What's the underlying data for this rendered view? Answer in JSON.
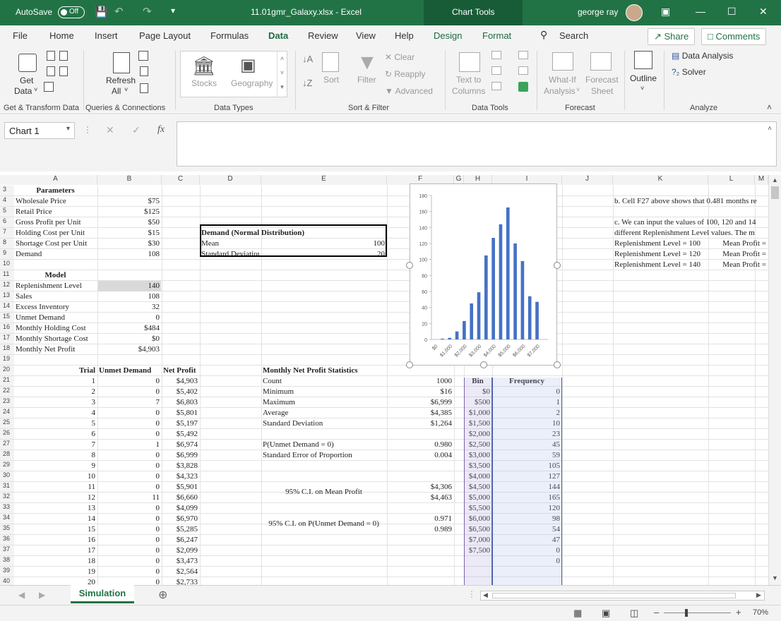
{
  "title_bar": {
    "autosave": "AutoSave",
    "autosave_state": "Off",
    "filename": "11.01gmr_Galaxy.xlsx  -  Excel",
    "context": "Chart Tools",
    "user": "george ray"
  },
  "tabs": [
    "File",
    "Home",
    "Insert",
    "Page Layout",
    "Formulas",
    "Data",
    "Review",
    "View",
    "Help",
    "Design",
    "Format"
  ],
  "search": "Search",
  "share": "Share",
  "comments": "Comments",
  "ribbon": {
    "get_data": "Get",
    "get_data2": "Data",
    "refresh": "Refresh",
    "refresh2": "All",
    "stocks": "Stocks",
    "geography": "Geography",
    "sort": "Sort",
    "filter": "Filter",
    "clear": "Clear",
    "reapply": "Reapply",
    "advanced": "Advanced",
    "text_to": "Text to",
    "columns": "Columns",
    "whatif": "What-If",
    "analysis": "Analysis",
    "forecast": "Forecast",
    "sheet": "Sheet",
    "outline": "Outline",
    "data_analysis": "Data Analysis",
    "solver": "Solver",
    "groups": [
      "Get & Transform Data",
      "Queries & Connections",
      "Data Types",
      "Sort & Filter",
      "Data Tools",
      "Forecast",
      "Analyze"
    ]
  },
  "name_box": "Chart 1",
  "columns": [
    "A",
    "B",
    "C",
    "D",
    "E",
    "F",
    "G",
    "H",
    "I",
    "J",
    "K",
    "L",
    "M"
  ],
  "params": {
    "title": "Parameters",
    "rows": [
      [
        "Wholesale Price",
        "$75"
      ],
      [
        "Retail Price",
        "$125"
      ],
      [
        "Gross Profit per Unit",
        "$50"
      ],
      [
        "Holding Cost per Unit",
        "$15"
      ],
      [
        "Shortage Cost per Unit",
        "$30"
      ],
      [
        "Demand",
        "108"
      ]
    ]
  },
  "demand_box": {
    "title": "Demand (Normal Distribution)",
    "mean_label": "Mean",
    "mean": "100",
    "sd_label": "Standard Deviation",
    "sd": "20"
  },
  "model": {
    "title": "Model",
    "rows": [
      [
        "Replenishment Level",
        "140"
      ],
      [
        "Sales",
        "108"
      ],
      [
        "Excess Inventory",
        "32"
      ],
      [
        "Unmet Demand",
        "0"
      ],
      [
        "Monthly Holding Cost",
        "$484"
      ],
      [
        "Monthly Shortage Cost",
        "$0"
      ],
      [
        "Monthly Net Profit",
        "$4,903"
      ]
    ]
  },
  "notes": {
    "k4": "b. Cell F27 above shows that 0.481 months re",
    "k6": "c. We can input the values of 100, 120 and 14",
    "k7": "different Replenishment Level values. The m",
    "rl": [
      [
        "Replenishment Level = 100",
        "Mean Profit ="
      ],
      [
        "Replenishment Level = 120",
        "Mean Profit ="
      ],
      [
        "Replenishment Level = 140",
        "Mean Profit ="
      ]
    ]
  },
  "trial_headers": [
    "Trial",
    "Unmet Demand",
    "Net Profit"
  ],
  "trials": [
    [
      "1",
      "0",
      "$4,903"
    ],
    [
      "2",
      "0",
      "$5,402"
    ],
    [
      "3",
      "7",
      "$6,803"
    ],
    [
      "4",
      "0",
      "$5,801"
    ],
    [
      "5",
      "0",
      "$5,197"
    ],
    [
      "6",
      "0",
      "$5,492"
    ],
    [
      "7",
      "1",
      "$6,974"
    ],
    [
      "8",
      "0",
      "$6,999"
    ],
    [
      "9",
      "0",
      "$3,828"
    ],
    [
      "10",
      "0",
      "$4,323"
    ],
    [
      "11",
      "0",
      "$5,901"
    ],
    [
      "12",
      "11",
      "$6,660"
    ],
    [
      "13",
      "0",
      "$4,099"
    ],
    [
      "14",
      "0",
      "$6,970"
    ],
    [
      "15",
      "0",
      "$5,285"
    ],
    [
      "16",
      "0",
      "$6,247"
    ],
    [
      "17",
      "0",
      "$2,099"
    ],
    [
      "18",
      "0",
      "$3,473"
    ],
    [
      "19",
      "0",
      "$2,564"
    ],
    [
      "20",
      "0",
      "$2,733"
    ]
  ],
  "stats": {
    "title": "Monthly Net Profit Statistics",
    "rows": [
      [
        "Count",
        "1000"
      ],
      [
        "Minimum",
        "$16"
      ],
      [
        "Maximum",
        "$6,999"
      ],
      [
        "Average",
        "$4,385"
      ],
      [
        "Standard Deviation",
        "$1,264"
      ]
    ],
    "p_unmet": "P(Unmet Demand = 0)",
    "p_unmet_val": "0.980",
    "se": "Standard Error of Proportion",
    "se_val": "0.004",
    "ci_mean": "95% C.I. on Mean Profit",
    "ci_mean_lo": "$4,306",
    "ci_mean_hi": "$4,463",
    "ci_p": "95% C.I. on P(Unmet Demand = 0)",
    "ci_p_lo": "0.971",
    "ci_p_hi": "0.989"
  },
  "bin_headers": [
    "Bin",
    "Frequency"
  ],
  "bins": [
    [
      "$0",
      "0"
    ],
    [
      "$500",
      "1"
    ],
    [
      "$1,000",
      "2"
    ],
    [
      "$1,500",
      "10"
    ],
    [
      "$2,000",
      "23"
    ],
    [
      "$2,500",
      "45"
    ],
    [
      "$3,000",
      "59"
    ],
    [
      "$3,500",
      "105"
    ],
    [
      "$4,000",
      "127"
    ],
    [
      "$4,500",
      "144"
    ],
    [
      "$5,000",
      "165"
    ],
    [
      "$5,500",
      "120"
    ],
    [
      "$6,000",
      "98"
    ],
    [
      "$6,500",
      "54"
    ],
    [
      "$7,000",
      "47"
    ],
    [
      "$7,500",
      "0"
    ],
    [
      "",
      "0"
    ]
  ],
  "chart_data": {
    "type": "bar",
    "categories": [
      "$0",
      "$500",
      "$1,000",
      "$1,500",
      "$2,000",
      "$2,500",
      "$3,000",
      "$3,500",
      "$4,000",
      "$4,500",
      "$5,000",
      "$5,500",
      "$6,000",
      "$6,500",
      "$7,000",
      "$7,500"
    ],
    "tick_labels": [
      "$0",
      "$1,000",
      "$2,000",
      "$3,000",
      "$4,000",
      "$5,000",
      "$6,000",
      "$7,000"
    ],
    "values": [
      0,
      1,
      2,
      10,
      23,
      45,
      59,
      105,
      127,
      144,
      165,
      120,
      98,
      54,
      47,
      0
    ],
    "ylim": [
      0,
      180
    ],
    "yticks": [
      0,
      20,
      40,
      60,
      80,
      100,
      120,
      140,
      160,
      180
    ],
    "color": "#4472c4"
  },
  "sheet_tab": "Simulation",
  "zoom": "70%"
}
